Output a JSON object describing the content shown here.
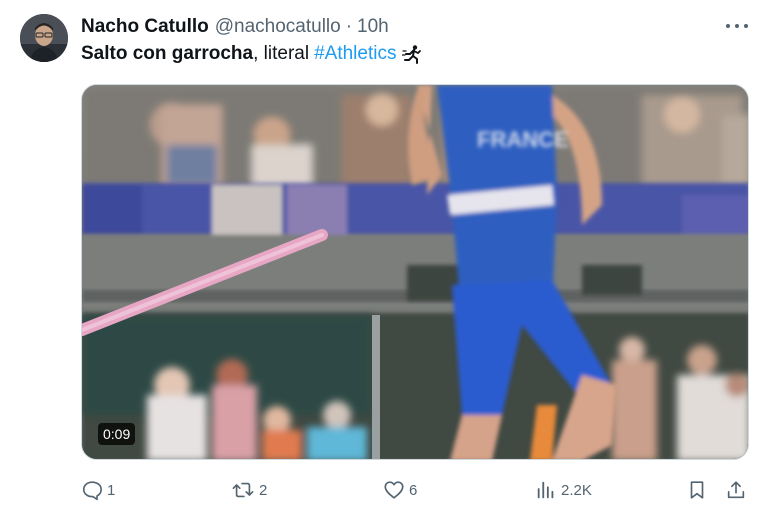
{
  "author": {
    "name": "Nacho Catullo",
    "handle": "@nachocatullo",
    "separator": "·",
    "time": "10h"
  },
  "tweet": {
    "text_bold": "Salto con garrocha",
    "text_rest": ", literal",
    "hashtag": "#Athletics",
    "emoji_icon": "runner-icon"
  },
  "media": {
    "duration": "0:09",
    "jersey_text": "FRANCE"
  },
  "actions": {
    "reply_count": "1",
    "retweet_count": "2",
    "like_count": "6",
    "views_count": "2.2K"
  },
  "colors": {
    "accent": "#1d9bf0",
    "secondary_text": "#536471",
    "primary_text": "#0f1419"
  }
}
